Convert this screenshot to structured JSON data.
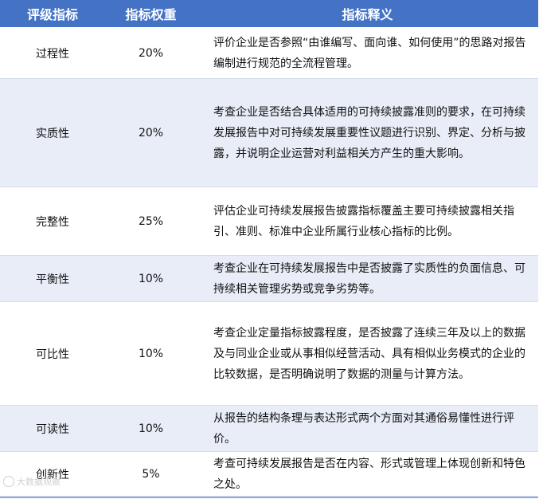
{
  "table": {
    "headers": [
      "评级指标",
      "指标权重",
      "指标释义"
    ],
    "rows": [
      {
        "name": "过程性",
        "weight": "20%",
        "desc": "评价企业是否参照“由谁编写、面向谁、如何使用”的思路对报告编制进行规范的全流程管理。"
      },
      {
        "name": "实质性",
        "weight": "20%",
        "desc": "考查企业是否结合具体适用的可持续披露准则的要求，在可持续发展报告中对可持续发展重要性议题进行识别、界定、分析与披露，并说明企业运营对利益相关方产生的重大影响。"
      },
      {
        "name": "完整性",
        "weight": "25%",
        "desc": "评估企业可持续发展报告披露指标覆盖主要可持续披露相关指引、准则、标准中企业所属行业核心指标的比例。"
      },
      {
        "name": "平衡性",
        "weight": "10%",
        "desc": "考查企业在可持续发展报告中是否披露了实质性的负面信息、可持续相关管理劣势或竞争劣势等。"
      },
      {
        "name": "可比性",
        "weight": "10%",
        "desc": "考查企业定量指标披露程度，是否披露了连续三年及以上的数据及与同业企业或从事相似经营活动、具有相似业务模式的企业的比较数据，是否明确说明了数据的测量与计算方法。"
      },
      {
        "name": "可读性",
        "weight": "10%",
        "desc": "从报告的结构条理与表达形式两个方面对其通俗易懂性进行评价。"
      },
      {
        "name": "创新性",
        "weight": "5%",
        "desc": "考查可持续发展报告是否在内容、形式或管理上体现创新和特色之处。"
      }
    ]
  },
  "watermark": "大数据观察"
}
